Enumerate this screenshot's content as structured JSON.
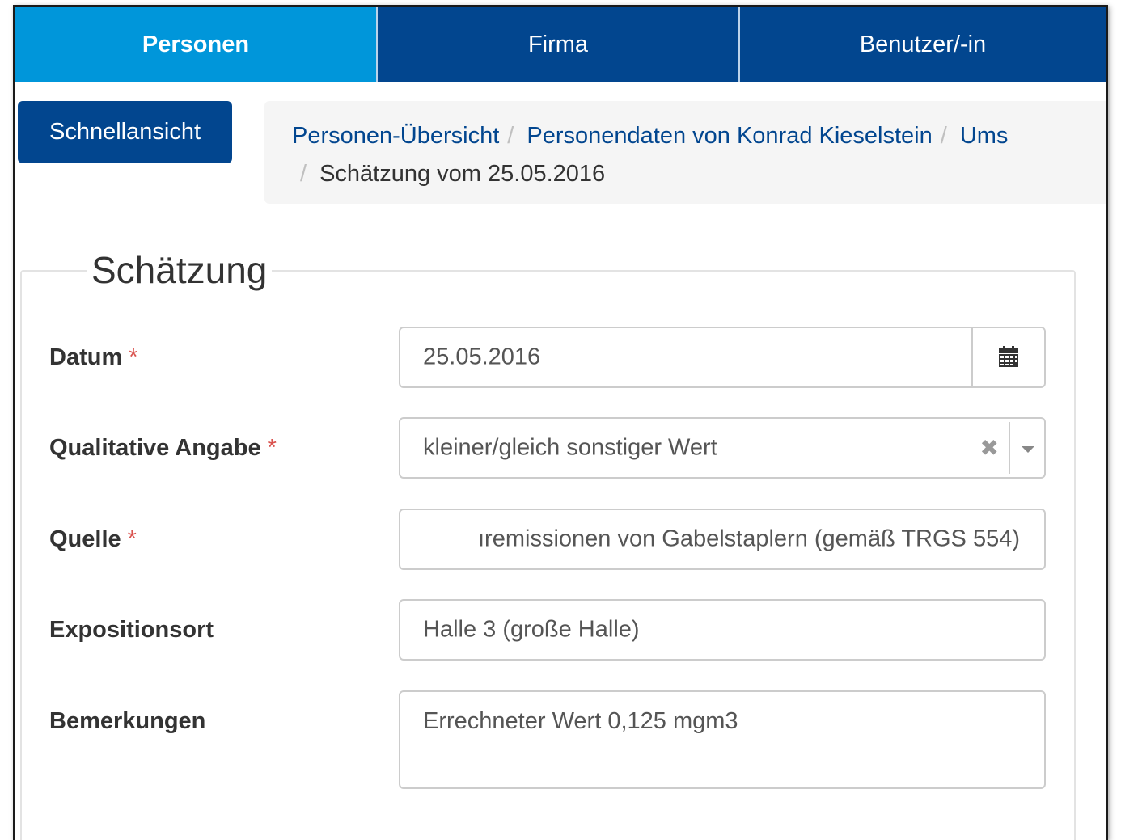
{
  "nav": {
    "tabs": [
      {
        "label": "Personen",
        "active": true
      },
      {
        "label": "Firma",
        "active": false
      },
      {
        "label": "Benutzer/-in",
        "active": false
      }
    ]
  },
  "quick_view_label": "Schnellansicht",
  "breadcrumb": {
    "link1": "Personen-Übersicht",
    "link2": "Personendaten von Konrad Kieselstein",
    "link3": "Ums",
    "separator": "/",
    "current": "Schätzung vom 25.05.2016"
  },
  "form": {
    "legend": "Schätzung",
    "required_mark": "*",
    "datum": {
      "label": "Datum",
      "value": "25.05.2016",
      "icon": "calendar-icon"
    },
    "qualitative": {
      "label": "Qualitative Angabe",
      "value": "kleiner/gleich sonstiger Wert",
      "clear_symbol": "✖"
    },
    "quelle": {
      "label": "Quelle",
      "value": "ıremissionen von Gabelstaplern (gemäß TRGS 554)"
    },
    "expositionsort": {
      "label": "Expositionsort",
      "value": "Halle 3 (große Halle)"
    },
    "bemerkungen": {
      "label": "Bemerkungen",
      "value": "Errechneter Wert 0,125 mgm3"
    }
  },
  "colors": {
    "nav_dark": "#02468f",
    "nav_active": "#0096da",
    "required": "#d9534f"
  }
}
